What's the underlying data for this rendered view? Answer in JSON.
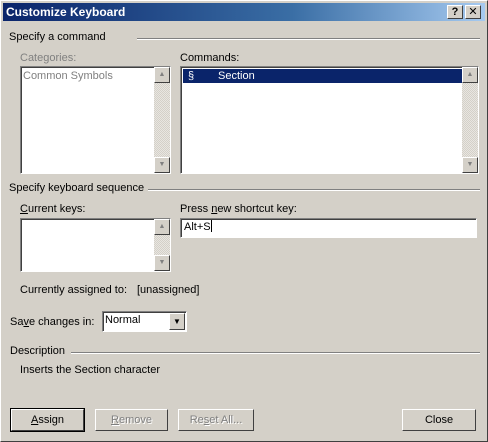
{
  "window": {
    "title": "Customize Keyboard",
    "help_glyph": "?",
    "close_glyph": "✕"
  },
  "specify_command": {
    "group_label": "Specify a command",
    "categories_label": "Categories:",
    "categories": [
      "Common Symbols"
    ],
    "commands_label": "Commands:",
    "commands": [
      {
        "symbol": "§",
        "name": "Section",
        "selected": true
      }
    ]
  },
  "keyboard_sequence": {
    "group_label": "Specify keyboard sequence",
    "current_keys_label": "Current keys:",
    "current_keys": [],
    "new_shortcut_label": "Press new shortcut key:",
    "new_shortcut_value": "Alt+S",
    "assigned_label": "Currently assigned to:",
    "assigned_value": "[unassigned]"
  },
  "save_changes": {
    "label": "Save changes in:",
    "selected": "Normal"
  },
  "description": {
    "group_label": "Description",
    "text": "Inserts the Section character"
  },
  "buttons": {
    "assign": "Assign",
    "remove": "Remove",
    "reset_all": "Reset All...",
    "close": "Close"
  },
  "icons": {
    "up": "▲",
    "down": "▼"
  }
}
